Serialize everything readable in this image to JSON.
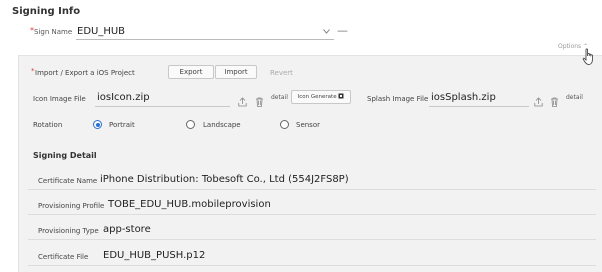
{
  "header": {
    "title": "Signing Info"
  },
  "sign_name": {
    "required_mark": "*",
    "label": "Sign Name",
    "value": "EDU_HUB",
    "remove_symbol": "—"
  },
  "options": {
    "label": "Options"
  },
  "project": {
    "required_mark": "*",
    "label": "Import / Export a iOS Project",
    "export_label": "Export",
    "import_label": "Import",
    "revert_label": "Revert"
  },
  "icon_image": {
    "label": "Icon Image File",
    "value": "iosIcon.zip",
    "detail_label": "detail",
    "generate_label": "Icon Generate"
  },
  "splash_image": {
    "label": "Splash Image File",
    "value": "iosSplash.zip",
    "detail_label": "detail"
  },
  "rotation": {
    "label": "Rotation",
    "options": [
      "Portrait",
      "Landscape",
      "Sensor"
    ],
    "selected": "Portrait"
  },
  "signing_detail": {
    "title": "Signing Detail",
    "rows": [
      {
        "label": "Certificate Name",
        "value": "iPhone Distribution: Tobesoft Co., Ltd (554J2FS8P)"
      },
      {
        "label": "Provisioning Profile",
        "value": "TOBE_EDU_HUB.mobileprovision"
      },
      {
        "label": "Provisioning Type",
        "value": "app-store"
      },
      {
        "label": "Certificate File",
        "value": "EDU_HUB_PUSH.p12"
      }
    ]
  },
  "colors": {
    "accent": "#2a6fd1",
    "required": "#e04040",
    "panel_bg": "#f2f2f2"
  }
}
